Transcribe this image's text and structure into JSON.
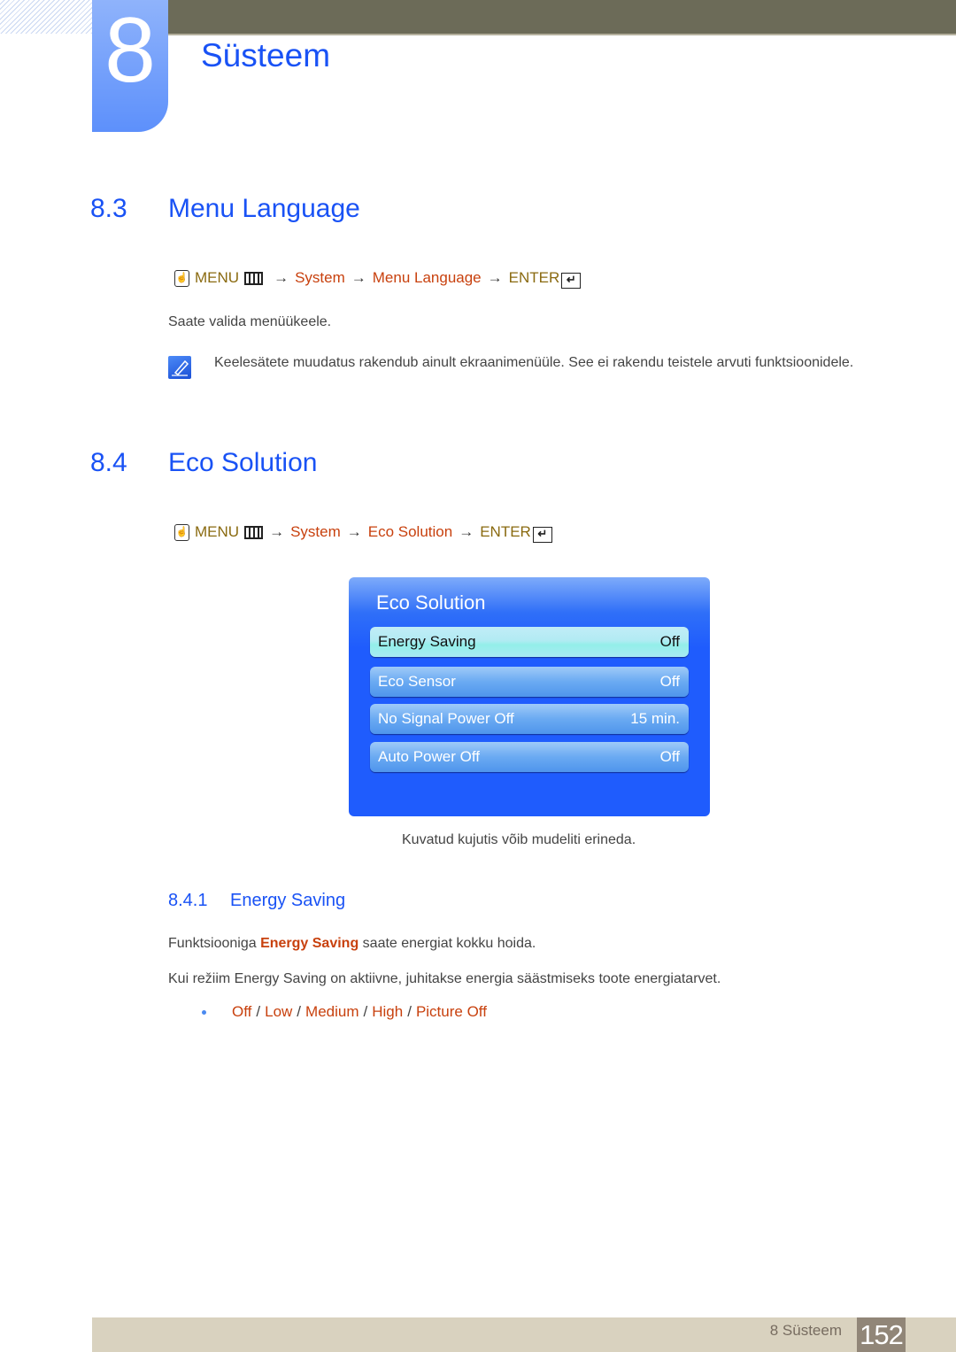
{
  "chapter": {
    "number": "8",
    "title": "Süsteem"
  },
  "sections": {
    "menu_language": {
      "number": "8.3",
      "title": "Menu Language",
      "path": {
        "menu": "MENU",
        "items": [
          "System",
          "Menu Language"
        ],
        "enter": "ENTER",
        "arrow": "→"
      },
      "description": "Saate valida menüükeele.",
      "note": "Keelesätete muudatus rakendub ainult ekraanimenüüle. See ei rakendu teistele arvuti funktsioonidele."
    },
    "eco_solution": {
      "number": "8.4",
      "title": "Eco Solution",
      "path": {
        "menu": "MENU",
        "items": [
          "System",
          "Eco Solution"
        ],
        "enter": "ENTER",
        "arrow": "→"
      },
      "osd": {
        "title": "Eco Solution",
        "rows": [
          {
            "label": "Energy Saving",
            "value": "Off",
            "selected": true
          },
          {
            "label": "Eco Sensor",
            "value": "Off"
          },
          {
            "label": "No Signal Power Off",
            "value": "15 min."
          },
          {
            "label": "Auto Power Off",
            "value": "Off"
          }
        ]
      },
      "caption": "Kuvatud kujutis võib mudeliti erineda."
    },
    "energy_saving": {
      "number": "8.4.1",
      "title": "Energy Saving",
      "para1_prefix": "Funktsiooniga ",
      "para1_highlight": "Energy Saving",
      "para1_suffix": " saate energiat kokku hoida.",
      "para2": "Kui režiim Energy Saving on aktiivne, juhitakse energia säästmiseks toote energiatarvet.",
      "options": [
        "Off",
        "Low",
        "Medium",
        "High",
        "Picture Off"
      ],
      "separator": "/"
    }
  },
  "footer": {
    "label": "8 Süsteem",
    "page": "152"
  },
  "colors": {
    "heading": "#1952f5",
    "menu_path": "#8a6a10",
    "menu_item": "#c8410e",
    "topbar": "#6c6b58",
    "footer": "#d9d2bf",
    "page_box": "#918678"
  }
}
